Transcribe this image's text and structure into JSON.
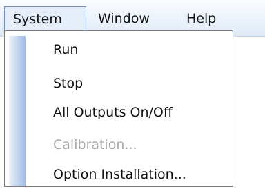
{
  "menubar": {
    "menus": [
      {
        "label": "System",
        "active": true
      },
      {
        "label": "Window",
        "active": false
      },
      {
        "label": "Help",
        "active": false
      }
    ]
  },
  "dropdown": {
    "items": [
      {
        "label": "Run",
        "enabled": true
      },
      {
        "label": "Stop",
        "enabled": true
      },
      {
        "label": "All Outputs On/Off",
        "enabled": true
      },
      {
        "label": "Calibration...",
        "enabled": false
      },
      {
        "label": "Option Installation...",
        "enabled": true
      }
    ]
  },
  "colors": {
    "accent_border": "#6e8fbf",
    "gutter_blue": "#9fbbe4",
    "disabled_text": "#a9a9a9"
  }
}
